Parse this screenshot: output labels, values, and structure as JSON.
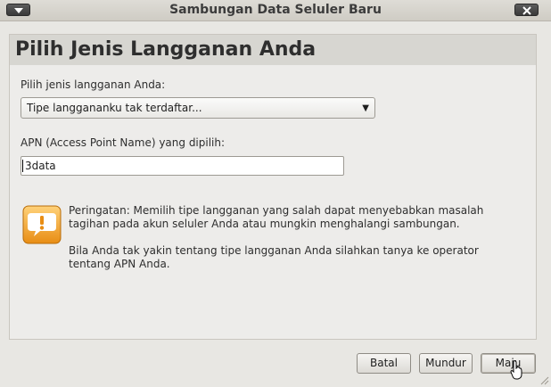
{
  "window": {
    "title": "Sambungan Data Seluler Baru"
  },
  "page": {
    "title": "Pilih Jenis Langganan Anda"
  },
  "plan": {
    "label": "Pilih jenis langganan Anda:",
    "selected": "Tipe langgananku tak terdaftar..."
  },
  "apn": {
    "label": "APN (Access Point Name) yang dipilih:",
    "value": "3data"
  },
  "warning": {
    "paragraph1": "Peringatan: Memilih tipe langganan yang salah dapat menyebabkan masalah tagihan pada akun seluler Anda atau mungkin menghalangi sambungan.",
    "paragraph2": "Bila Anda tak yakin tentang tipe langganan Anda silahkan tanya ke operator tentang APN Anda.",
    "icon": "warning-speech-bubble-icon"
  },
  "buttons": {
    "cancel": "Batal",
    "back": "Mundur",
    "forward": "Maju"
  },
  "colors": {
    "warning_icon": "#f2a32a"
  }
}
